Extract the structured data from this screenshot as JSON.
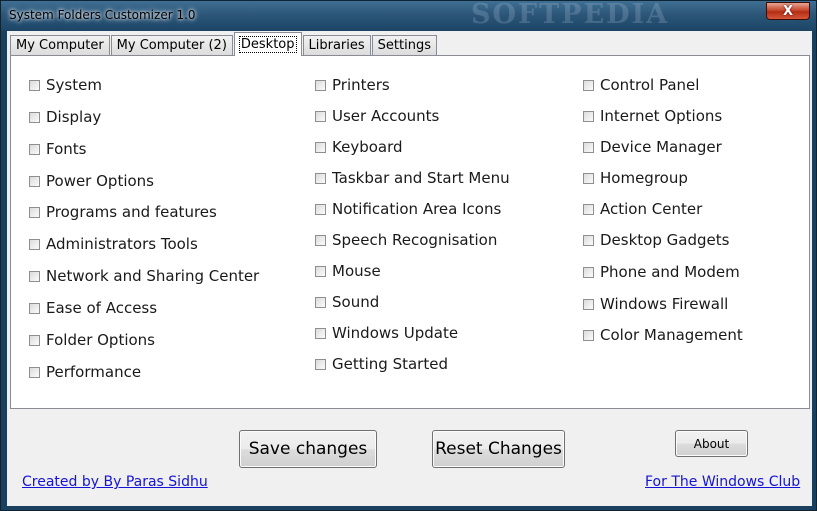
{
  "window": {
    "title": "System Folders Customizer 1.0",
    "watermark": "SOFTPEDIA",
    "close_symbol": "X"
  },
  "tabs": [
    {
      "label": "My Computer"
    },
    {
      "label": "My Computer (2)"
    },
    {
      "label": "Desktop",
      "active": true
    },
    {
      "label": "Libraries"
    },
    {
      "label": "Settings"
    }
  ],
  "columns": [
    [
      "System",
      "Display",
      "Fonts",
      "Power Options",
      "Programs and features",
      "Administrators Tools",
      "Network and Sharing Center",
      "Ease of Access",
      "Folder Options",
      "Performance"
    ],
    [
      "Printers",
      "User Accounts",
      "Keyboard",
      "Taskbar and Start Menu",
      "Notification Area Icons",
      "Speech Recognisation",
      "Mouse",
      "Sound",
      "Windows Update",
      "Getting Started"
    ],
    [
      "Control Panel",
      "Internet Options",
      "Device Manager",
      "Homegroup",
      "Action Center",
      "Desktop Gadgets",
      "Phone and Modem",
      "Windows Firewall",
      "Color Management"
    ]
  ],
  "buttons": {
    "save": "Save changes",
    "reset": "Reset Changes",
    "about": "About"
  },
  "links": {
    "credit": "Created by By Paras Sidhu",
    "club": "For The Windows Club"
  },
  "colors": {
    "link": "#1414d8",
    "close": "#c8492f"
  }
}
